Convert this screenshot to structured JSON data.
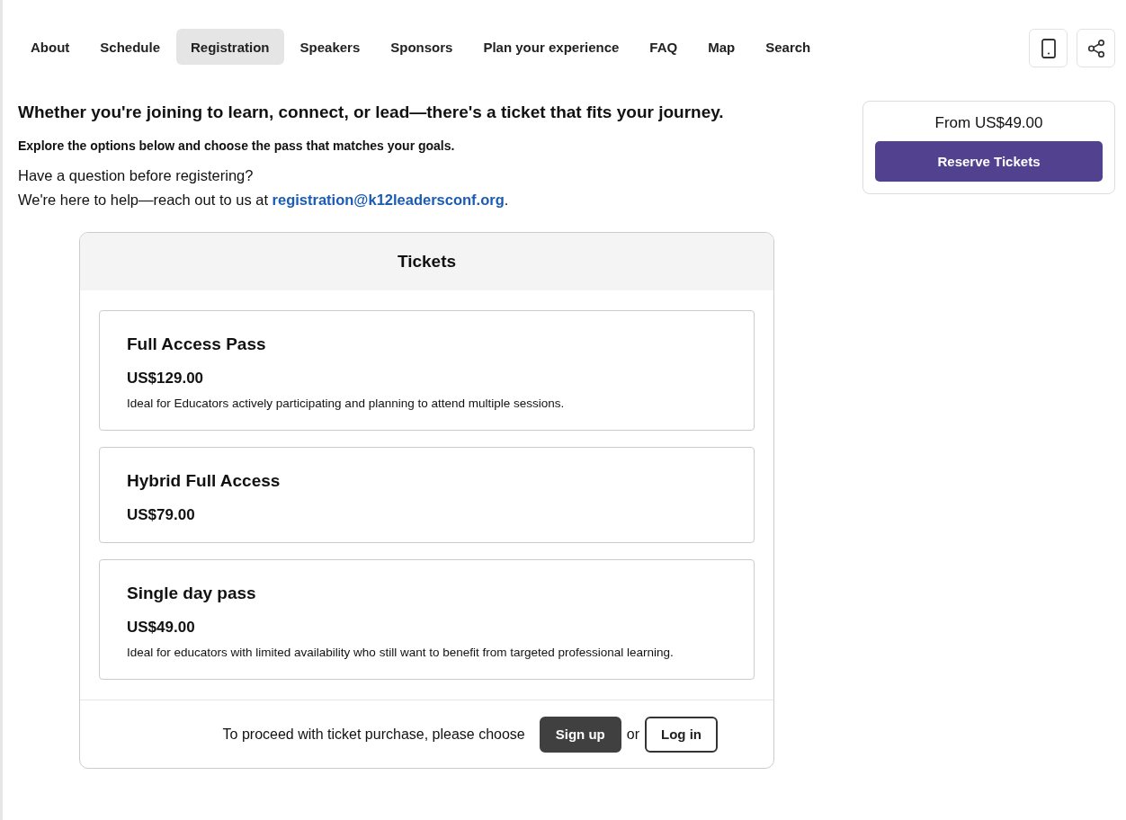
{
  "nav": {
    "tabs": [
      {
        "label": "About",
        "selected": false
      },
      {
        "label": "Schedule",
        "selected": false
      },
      {
        "label": "Registration",
        "selected": true
      },
      {
        "label": "Speakers",
        "selected": false
      },
      {
        "label": "Sponsors",
        "selected": false
      },
      {
        "label": "Plan your experience",
        "selected": false
      },
      {
        "label": "FAQ",
        "selected": false
      },
      {
        "label": "Map",
        "selected": false
      },
      {
        "label": "Search",
        "selected": false
      }
    ]
  },
  "intro": {
    "heading": "Whether you're joining to learn, connect, or lead—there's a ticket that fits your journey.",
    "subheading": "Explore the options below and choose the pass that matches your goals.",
    "question": "Have a question before registering?",
    "help_text": "We're here to help—reach out to us at ",
    "email": "registration@k12leadersconf.org",
    "help_end": "."
  },
  "tickets": {
    "title": "Tickets",
    "items": [
      {
        "name": "Full Access Pass",
        "price": "US$129.00",
        "description": "Ideal for Educators actively participating and planning to attend multiple sessions."
      },
      {
        "name": "Hybrid Full Access",
        "price": "US$79.00"
      },
      {
        "name": "Single day pass",
        "price": "US$49.00",
        "description": "Ideal for educators with limited availability who still want to benefit from targeted professional learning."
      }
    ],
    "footer": {
      "prompt": "To proceed with ticket purchase, please choose",
      "signup": "Sign up",
      "or": "or",
      "login": "Log in"
    }
  },
  "sidebar": {
    "price": "From US$49.00",
    "button": "Reserve Tickets"
  }
}
